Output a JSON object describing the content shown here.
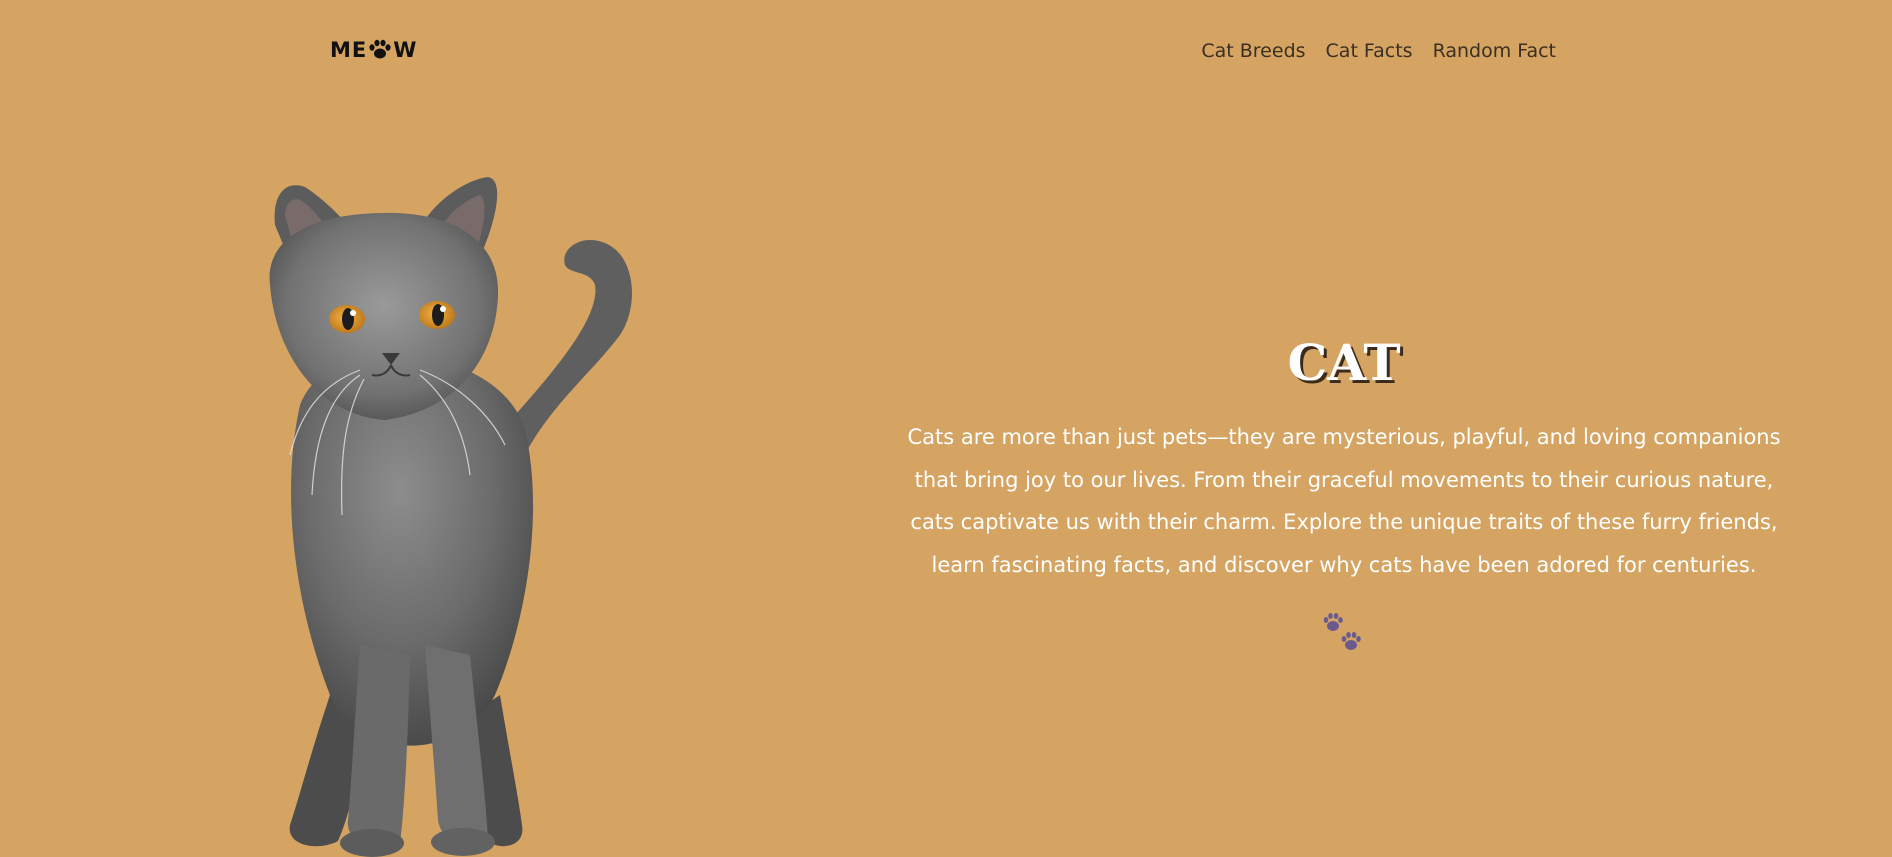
{
  "header": {
    "logo_text": {
      "first": "ME",
      "last": "W"
    },
    "logo_icon": "paw-icon"
  },
  "nav": {
    "items": [
      {
        "label": "Cat Breeds"
      },
      {
        "label": "Cat Facts"
      },
      {
        "label": "Random Fact"
      }
    ]
  },
  "hero": {
    "image": "gray-cat-photo",
    "title": "CAT",
    "description": "Cats are more than just pets—they are mysterious, playful, and loving companions that bring joy to our lives. From their graceful movements to their curious nature, cats captivate us with their charm. Explore the unique traits of these furry friends, learn fascinating facts, and discover why cats have been adored for centuries.",
    "icon": "paw-prints-icon"
  },
  "colors": {
    "background": "#d6a462",
    "paw_accent": "#6a5a8e",
    "title_text": "#ffffff",
    "nav_text": "#3a2f22"
  }
}
